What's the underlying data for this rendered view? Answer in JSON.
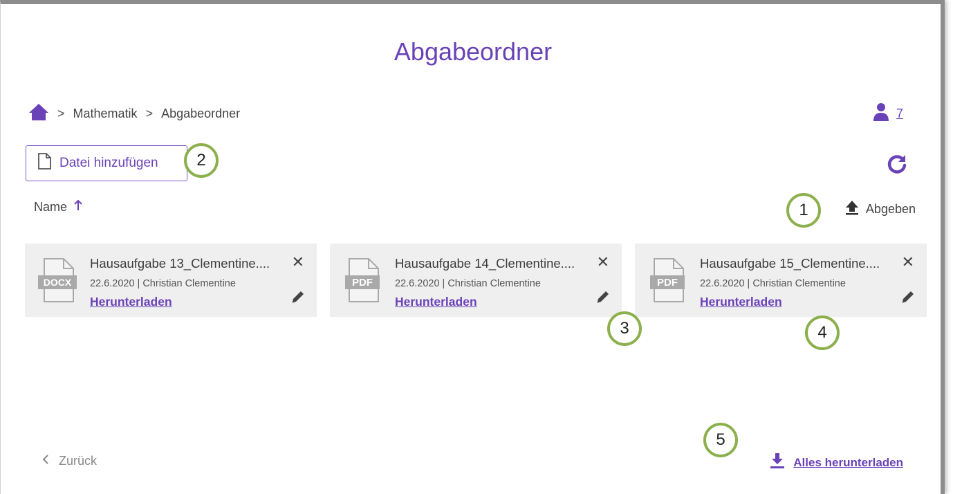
{
  "page": {
    "title": "Abgabeordner"
  },
  "breadcrumb": {
    "items": [
      "Mathematik",
      "Abgabeordner"
    ],
    "separator": ">"
  },
  "members": {
    "icon": "user-icon",
    "count": "7"
  },
  "toolbar": {
    "add_file_label": "Datei hinzufügen",
    "refresh_icon": "refresh-icon"
  },
  "list_header": {
    "name_label": "Name",
    "sort_icon": "arrow-up-icon",
    "submit_label": "Abgeben"
  },
  "files": [
    {
      "name": "Hausaufgabe 13_Clementine....",
      "type": "DOCX",
      "meta": "22.6.2020 | Christian Clementine",
      "download": "Herunterladen"
    },
    {
      "name": "Hausaufgabe 14_Clementine....",
      "type": "PDF",
      "meta": "22.6.2020 | Christian Clementine",
      "download": "Herunterladen"
    },
    {
      "name": "Hausaufgabe 15_Clementine....",
      "type": "PDF",
      "meta": "22.6.2020 | Christian Clementine",
      "download": "Herunterladen"
    }
  ],
  "footer": {
    "back_label": "Zurück",
    "download_all_label": "Alles herunterladen"
  },
  "callouts": [
    "1",
    "2",
    "3",
    "4",
    "5"
  ],
  "colors": {
    "accent": "#6a42b8",
    "callout_border": "#8cb04d",
    "card_bg": "#efefef"
  }
}
